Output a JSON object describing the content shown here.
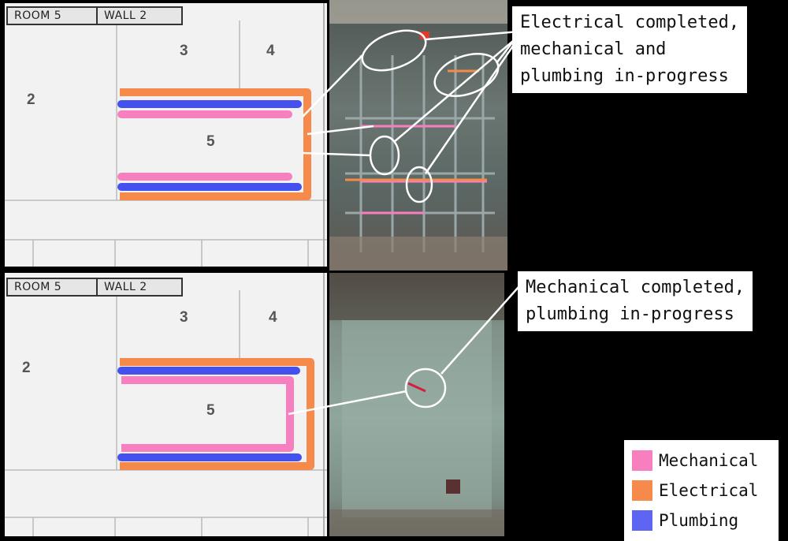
{
  "panels": [
    {
      "room_label": "ROOM 5",
      "wall_label": "WALL 2",
      "zones": [
        "2",
        "3",
        "4",
        "5"
      ],
      "callout": "Electrical completed,\nmechanical and\nplumbing in-progress"
    },
    {
      "room_label": "ROOM 5",
      "wall_label": "WALL 2",
      "zones": [
        "2",
        "3",
        "4",
        "5"
      ],
      "callout": "Mechanical completed,\nplumbing in-progress"
    }
  ],
  "legend": [
    {
      "label": "Mechanical",
      "color": "#f77fbf"
    },
    {
      "label": "Electrical",
      "color": "#f58a4a"
    },
    {
      "label": "Plumbing",
      "color": "#5d65f2"
    }
  ],
  "colors": {
    "mechanical": "#f77fbf",
    "electrical": "#f58a4a",
    "plumbing": "#4451ee",
    "callout_line": "#ffffff"
  }
}
